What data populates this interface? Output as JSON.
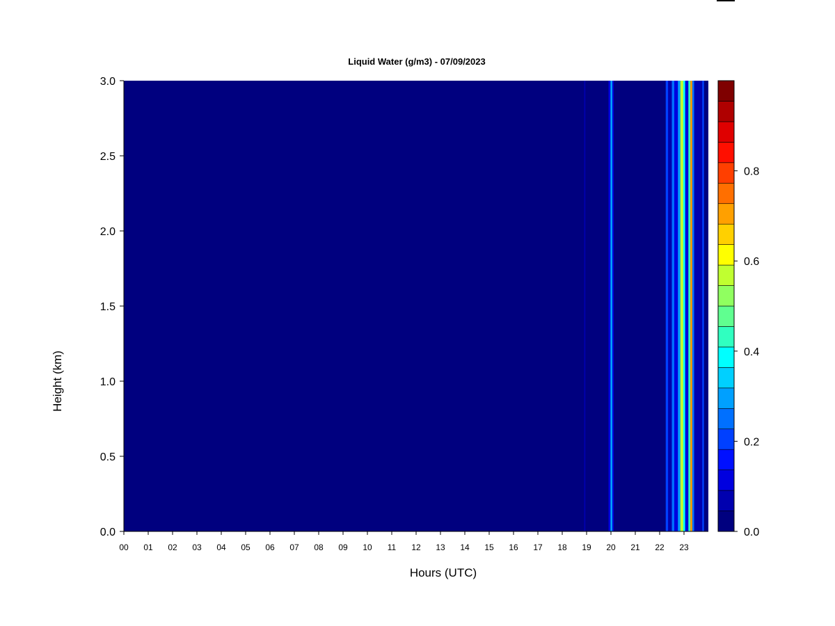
{
  "chart_data": {
    "type": "heatmap",
    "title": "Liquid Water (g/m3) - 07/09/2023",
    "xlabel": "Hours (UTC)",
    "ylabel": "Height (km)",
    "xlim": [
      0,
      24
    ],
    "ylim": [
      0.0,
      3.0
    ],
    "x_tick_labels": [
      "00",
      "01",
      "02",
      "03",
      "04",
      "05",
      "06",
      "07",
      "08",
      "09",
      "10",
      "11",
      "12",
      "13",
      "14",
      "15",
      "16",
      "17",
      "18",
      "19",
      "20",
      "21",
      "22",
      "23"
    ],
    "y_tick_labels": [
      "0.0",
      "0.5",
      "1.0",
      "1.5",
      "2.0",
      "2.5",
      "3.0"
    ],
    "y_ticks": [
      0.0,
      0.5,
      1.0,
      1.5,
      2.0,
      2.5,
      3.0
    ],
    "colorbar": {
      "min": 0.0,
      "max": 0.95,
      "step": 0.05,
      "tick_labels": [
        "0.0",
        "0.2",
        "0.4",
        "0.6",
        "0.8"
      ],
      "tick_values": [
        0.0,
        0.2,
        0.4,
        0.6,
        0.8
      ],
      "colors": [
        "#00007F",
        "#0000AF",
        "#0000DF",
        "#0010FF",
        "#0040FF",
        "#0070FF",
        "#00A0FF",
        "#00D0FF",
        "#00FFFF",
        "#30FFC0",
        "#60FF90",
        "#90FF60",
        "#C0FF30",
        "#FFFF00",
        "#FFD000",
        "#FFA000",
        "#FF6F00",
        "#FF3F00",
        "#FF0F00",
        "#DF0000",
        "#AF0000",
        "#7F0000"
      ]
    },
    "background_value": 0.0,
    "events": [
      {
        "hour_start": 18.9,
        "hour_end": 18.95,
        "value": 0.05
      },
      {
        "hour_start": 19.9,
        "hour_end": 19.98,
        "value": 0.12
      },
      {
        "hour_start": 19.98,
        "hour_end": 20.06,
        "value": 0.32
      },
      {
        "hour_start": 20.06,
        "hour_end": 20.12,
        "value": 0.15
      },
      {
        "hour_start": 20.12,
        "hour_end": 21.3,
        "value": 0.04
      },
      {
        "hour_start": 22.25,
        "hour_end": 22.35,
        "value": 0.2
      },
      {
        "hour_start": 22.35,
        "hour_end": 22.5,
        "value": 0.08
      },
      {
        "hour_start": 22.5,
        "hour_end": 22.6,
        "value": 0.25
      },
      {
        "hour_start": 22.6,
        "hour_end": 22.75,
        "value": 0.1
      },
      {
        "hour_start": 22.75,
        "hour_end": 22.85,
        "value": 0.35
      },
      {
        "hour_start": 22.85,
        "hour_end": 22.97,
        "value": 0.62
      },
      {
        "hour_start": 22.97,
        "hour_end": 23.05,
        "value": 0.4
      },
      {
        "hour_start": 23.05,
        "hour_end": 23.18,
        "value": 0.12
      },
      {
        "hour_start": 23.18,
        "hour_end": 23.26,
        "value": 0.45
      },
      {
        "hour_start": 23.26,
        "hour_end": 23.34,
        "value": 0.78
      },
      {
        "hour_start": 23.34,
        "hour_end": 23.42,
        "value": 0.3
      },
      {
        "hour_start": 23.42,
        "hour_end": 23.75,
        "value": 0.07
      },
      {
        "hour_start": 23.75,
        "hour_end": 23.82,
        "value": 0.22
      }
    ]
  }
}
